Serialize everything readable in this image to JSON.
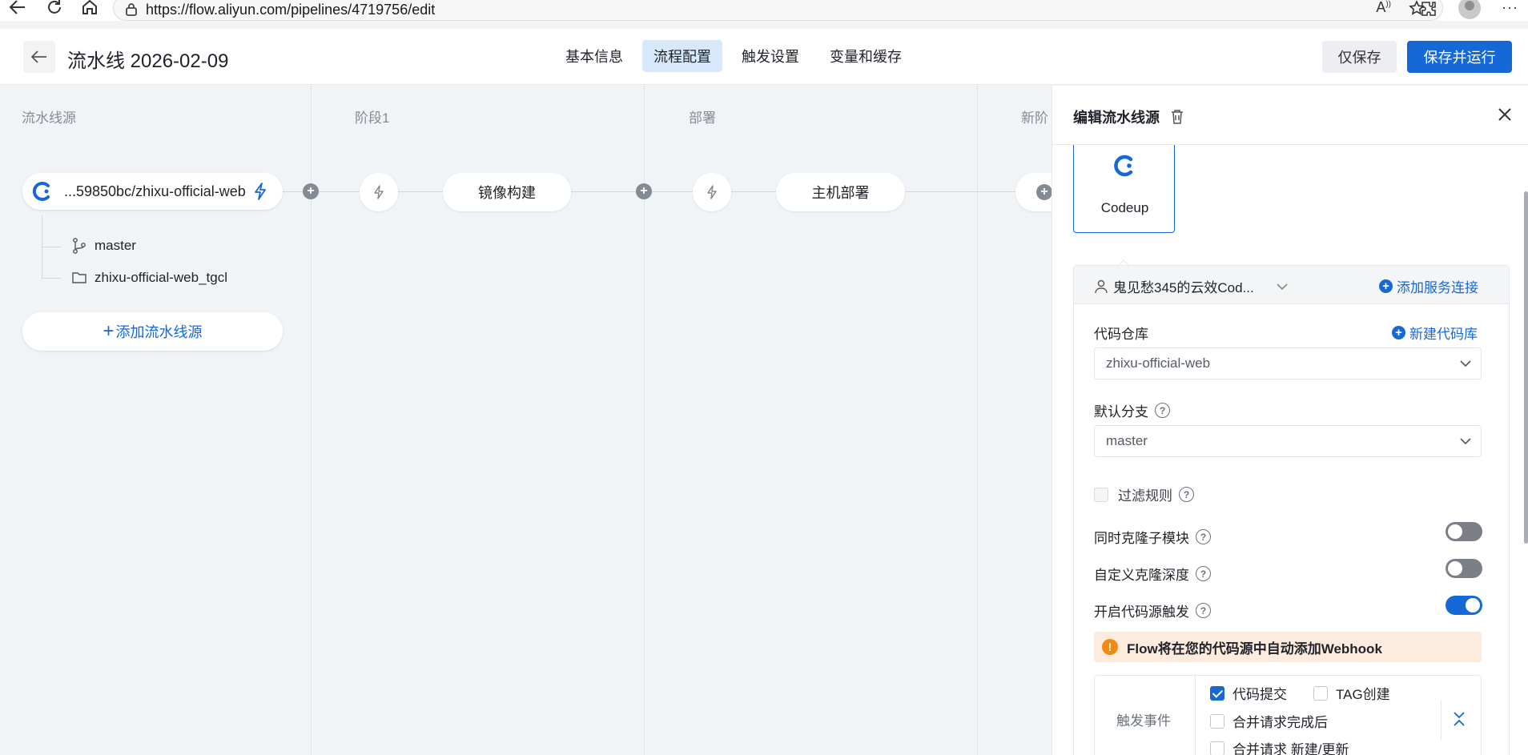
{
  "browser": {
    "url": "https://flow.aliyun.com/pipelines/4719756/edit"
  },
  "header": {
    "title": "流水线 2026-02-09",
    "tabs": [
      {
        "label": "基本信息",
        "active": false
      },
      {
        "label": "流程配置",
        "active": true
      },
      {
        "label": "触发设置",
        "active": false
      },
      {
        "label": "变量和缓存",
        "active": false
      }
    ],
    "save_only_label": "仅保存",
    "save_run_label": "保存并运行"
  },
  "canvas": {
    "columns": [
      {
        "title": "流水线源"
      },
      {
        "title": "阶段1"
      },
      {
        "title": "部署"
      },
      {
        "title": "新阶"
      }
    ],
    "source": {
      "repo_text": "...59850bc/zhixu-official-web",
      "branch": "master",
      "folder": "zhixu-official-web_tgcl",
      "add_label": "添加流水线源"
    },
    "jobs": [
      {
        "label": "镜像构建"
      },
      {
        "label": "主机部署"
      }
    ]
  },
  "panel": {
    "title": "编辑流水线源",
    "source_type": "Codeup",
    "service_connection": "鬼见愁345的云效Cod...",
    "add_connection_label": "添加服务连接",
    "repo": {
      "label": "代码仓库",
      "new_label": "新建代码库",
      "value": "zhixu-official-web"
    },
    "branch": {
      "label": "默认分支",
      "value": "master"
    },
    "filter_rules_label": "过滤规则",
    "toggles": [
      {
        "label": "同时克隆子模块",
        "on": false
      },
      {
        "label": "自定义克隆深度",
        "on": false
      },
      {
        "label": "开启代码源触发",
        "on": true
      }
    ],
    "notice": "Flow将在您的代码源中自动添加Webhook",
    "trigger_events": {
      "label": "触发事件",
      "items": [
        {
          "label": "代码提交",
          "checked": true
        },
        {
          "label": "TAG创建",
          "checked": false
        },
        {
          "label": "合并请求完成后",
          "checked": false
        },
        {
          "label": "合并请求 新建/更新",
          "checked": false
        }
      ]
    }
  },
  "colors": {
    "brand": "#1668d6",
    "active_tab_bg": "#d7e8fb",
    "notice_bg": "#fdebdd",
    "warning": "#f08a13"
  }
}
